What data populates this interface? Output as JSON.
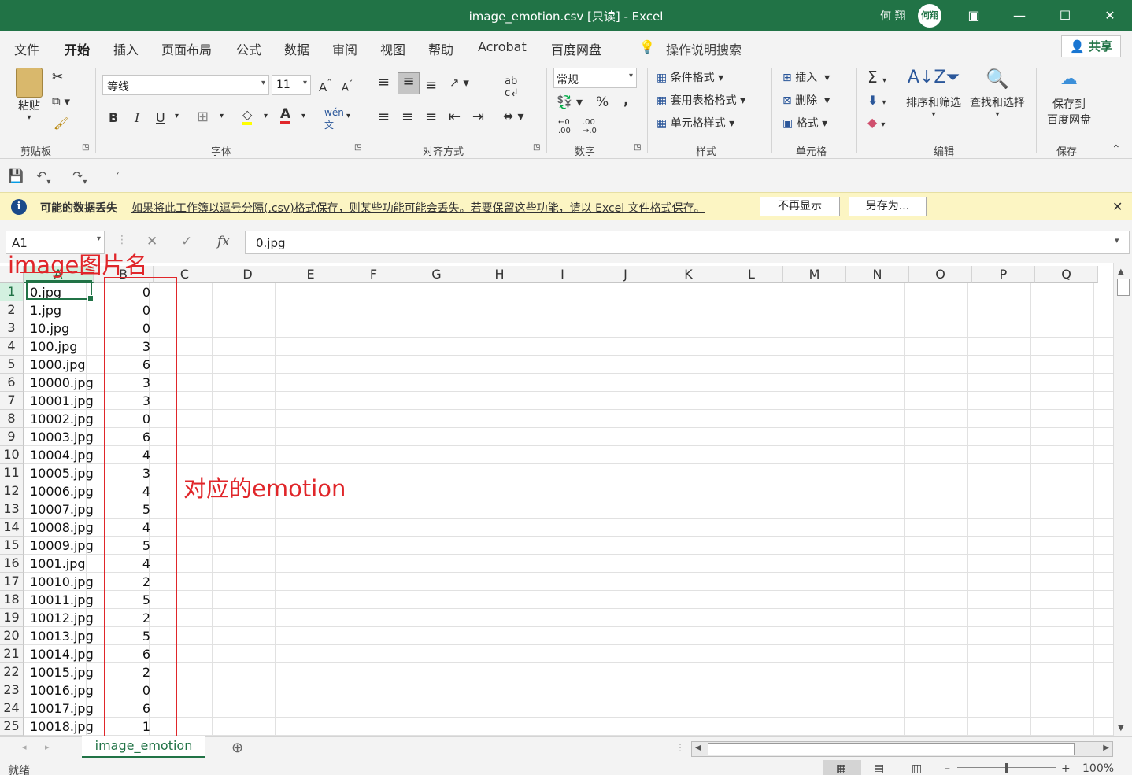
{
  "window": {
    "title": "image_emotion.csv  [只读]  -  Excel",
    "user": "何 翔",
    "avatar_initials": "何翔",
    "buttons": [
      "ribbon-display-icon",
      "minimize-icon",
      "maximize-icon",
      "close-icon"
    ]
  },
  "ribbon_tabs": [
    "文件",
    "开始",
    "插入",
    "页面布局",
    "公式",
    "数据",
    "审阅",
    "视图",
    "帮助",
    "Acrobat",
    "百度网盘"
  ],
  "active_tab": "开始",
  "tell_me": "操作说明搜索",
  "share_label": "共享",
  "ribbon": {
    "clipboard": {
      "paste": "粘贴",
      "label": "剪贴板"
    },
    "font": {
      "name": "等线",
      "size": "11",
      "bold": "B",
      "italic": "I",
      "underline": "U",
      "label": "字体",
      "color_red": "#e0262a",
      "highlight_yellow": "#ffff00"
    },
    "alignment": {
      "label": "对齐方式"
    },
    "number": {
      "format": "常规",
      "percent": "%",
      "comma": ",",
      "label": "数字"
    },
    "styles": {
      "conditional": "条件格式",
      "table": "套用表格格式",
      "cell": "单元格样式",
      "label": "样式"
    },
    "cells": {
      "insert": "插入",
      "delete": "删除",
      "format": "格式",
      "label": "单元格"
    },
    "editing": {
      "sort": "排序和筛选",
      "find": "查找和选择",
      "label": "编辑"
    },
    "save": {
      "line1": "保存到",
      "line2": "百度网盘",
      "label": "保存"
    }
  },
  "message_bar": {
    "title": "可能的数据丢失",
    "text": "如果将此工作簿以逗号分隔(.csv)格式保存，则某些功能可能会丢失。若要保留这些功能，请以 Excel 文件格式保存。",
    "btn_dismiss": "不再显示",
    "btn_saveas": "另存为..."
  },
  "formula_bar": {
    "name_box": "A1",
    "fx": "fx",
    "value": "0.jpg"
  },
  "columns": [
    "A",
    "B",
    "C",
    "D",
    "E",
    "F",
    "G",
    "H",
    "I",
    "J",
    "K",
    "L",
    "M",
    "N",
    "O",
    "P",
    "Q"
  ],
  "rows": [
    [
      "0.jpg",
      "0"
    ],
    [
      "1.jpg",
      "0"
    ],
    [
      "10.jpg",
      "0"
    ],
    [
      "100.jpg",
      "3"
    ],
    [
      "1000.jpg",
      "6"
    ],
    [
      "10000.jpg",
      "3"
    ],
    [
      "10001.jpg",
      "3"
    ],
    [
      "10002.jpg",
      "0"
    ],
    [
      "10003.jpg",
      "6"
    ],
    [
      "10004.jpg",
      "4"
    ],
    [
      "10005.jpg",
      "3"
    ],
    [
      "10006.jpg",
      "4"
    ],
    [
      "10007.jpg",
      "5"
    ],
    [
      "10008.jpg",
      "4"
    ],
    [
      "10009.jpg",
      "5"
    ],
    [
      "1001.jpg",
      "4"
    ],
    [
      "10010.jpg",
      "2"
    ],
    [
      "10011.jpg",
      "5"
    ],
    [
      "10012.jpg",
      "2"
    ],
    [
      "10013.jpg",
      "5"
    ],
    [
      "10014.jpg",
      "6"
    ],
    [
      "10015.jpg",
      "2"
    ],
    [
      "10016.jpg",
      "0"
    ],
    [
      "10017.jpg",
      "6"
    ],
    [
      "10018.jpg",
      "1"
    ]
  ],
  "annotations": {
    "col_a": "image图片名",
    "col_b": "对应的emotion",
    "color": "#e0262a"
  },
  "sheet_tab": "image_emotion",
  "status": {
    "ready": "就绪",
    "zoom": "100%"
  },
  "theme": {
    "excel_green": "#217346"
  }
}
